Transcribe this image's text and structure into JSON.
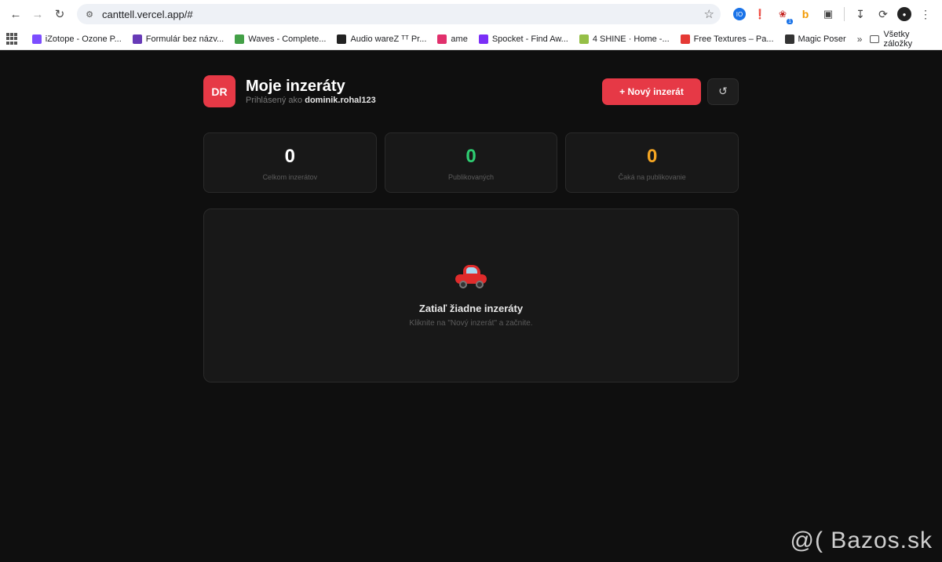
{
  "browser": {
    "url": "canttell.vercel.app/#",
    "bookmarks": [
      {
        "label": "iZotope - Ozone P...",
        "color": "#7c4dff"
      },
      {
        "label": "Formulár bez názv...",
        "color": "#673ab7"
      },
      {
        "label": "Waves - Complete...",
        "color": "#43a047"
      },
      {
        "label": "Audio wareZ ᵀᵀ Pr...",
        "color": "#222222"
      },
      {
        "label": "ame",
        "color": "#e1306c"
      },
      {
        "label": "Spocket - Find Aw...",
        "color": "#7b2ff7"
      },
      {
        "label": "4 SHINE · Home -...",
        "color": "#95bf47"
      },
      {
        "label": "Free Textures – Pa...",
        "color": "#e53935"
      },
      {
        "label": "Magic Poser",
        "color": "#333333"
      }
    ],
    "all_bookmarks_label": "Všetky záložky",
    "ext_badge": "1",
    "ext_label_1": "IO",
    "ext_label_4": "b"
  },
  "app": {
    "avatar_initials": "DR",
    "title": "Moje inzeráty",
    "subtitle_prefix": "Prihlásený ako",
    "username": "dominik.rohal123",
    "new_button_label": "+ Nový inzerát",
    "stats": [
      {
        "value": "0",
        "label": "Celkom inzerátov",
        "color": "#ffffff"
      },
      {
        "value": "0",
        "label": "Publikovaných",
        "color": "#2ecc71"
      },
      {
        "value": "0",
        "label": "Čaká na publikovanie",
        "color": "#f5a623"
      }
    ],
    "empty_title": "Zatiaľ žiadne inzeráty",
    "empty_subtitle": "Kliknite na \"Nový inzerát\" a začnite."
  },
  "watermark": "@( Bazos.sk"
}
